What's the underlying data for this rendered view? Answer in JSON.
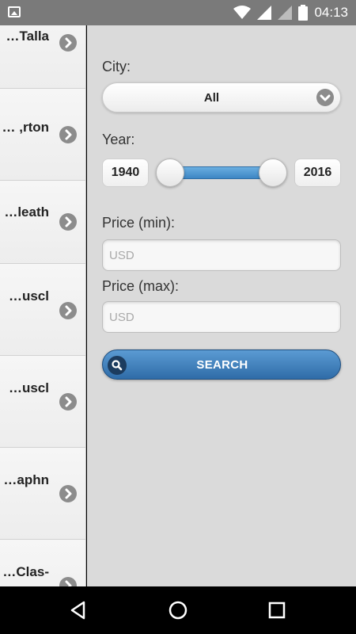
{
  "status_bar": {
    "time": "04:13",
    "icons": [
      "image-icon",
      "wifi-icon",
      "signal-icon",
      "signal-empty-icon",
      "battery-icon"
    ]
  },
  "list": {
    "items": [
      {
        "label": "Talla…"
      },
      {
        "label": "rton, …"
      },
      {
        "label": "leath…"
      },
      {
        "label": "uscl…"
      },
      {
        "label": "uscl…"
      },
      {
        "label": "aphn…"
      },
      {
        "label": "-Clas…"
      }
    ],
    "item_icon": "chevron-right-circle-icon"
  },
  "filter": {
    "city_label": "City:",
    "city_value": "All",
    "year_label": "Year:",
    "year_min": "1940",
    "year_max": "2016",
    "price_min_label": "Price (min):",
    "price_min_placeholder": "USD",
    "price_max_label": "Price (max):",
    "price_max_placeholder": "USD",
    "search_label": "SEARCH"
  },
  "colors": {
    "accent": "#3d86c4",
    "panel_bg": "#dadada",
    "status_bar": "#7a7a7a"
  }
}
